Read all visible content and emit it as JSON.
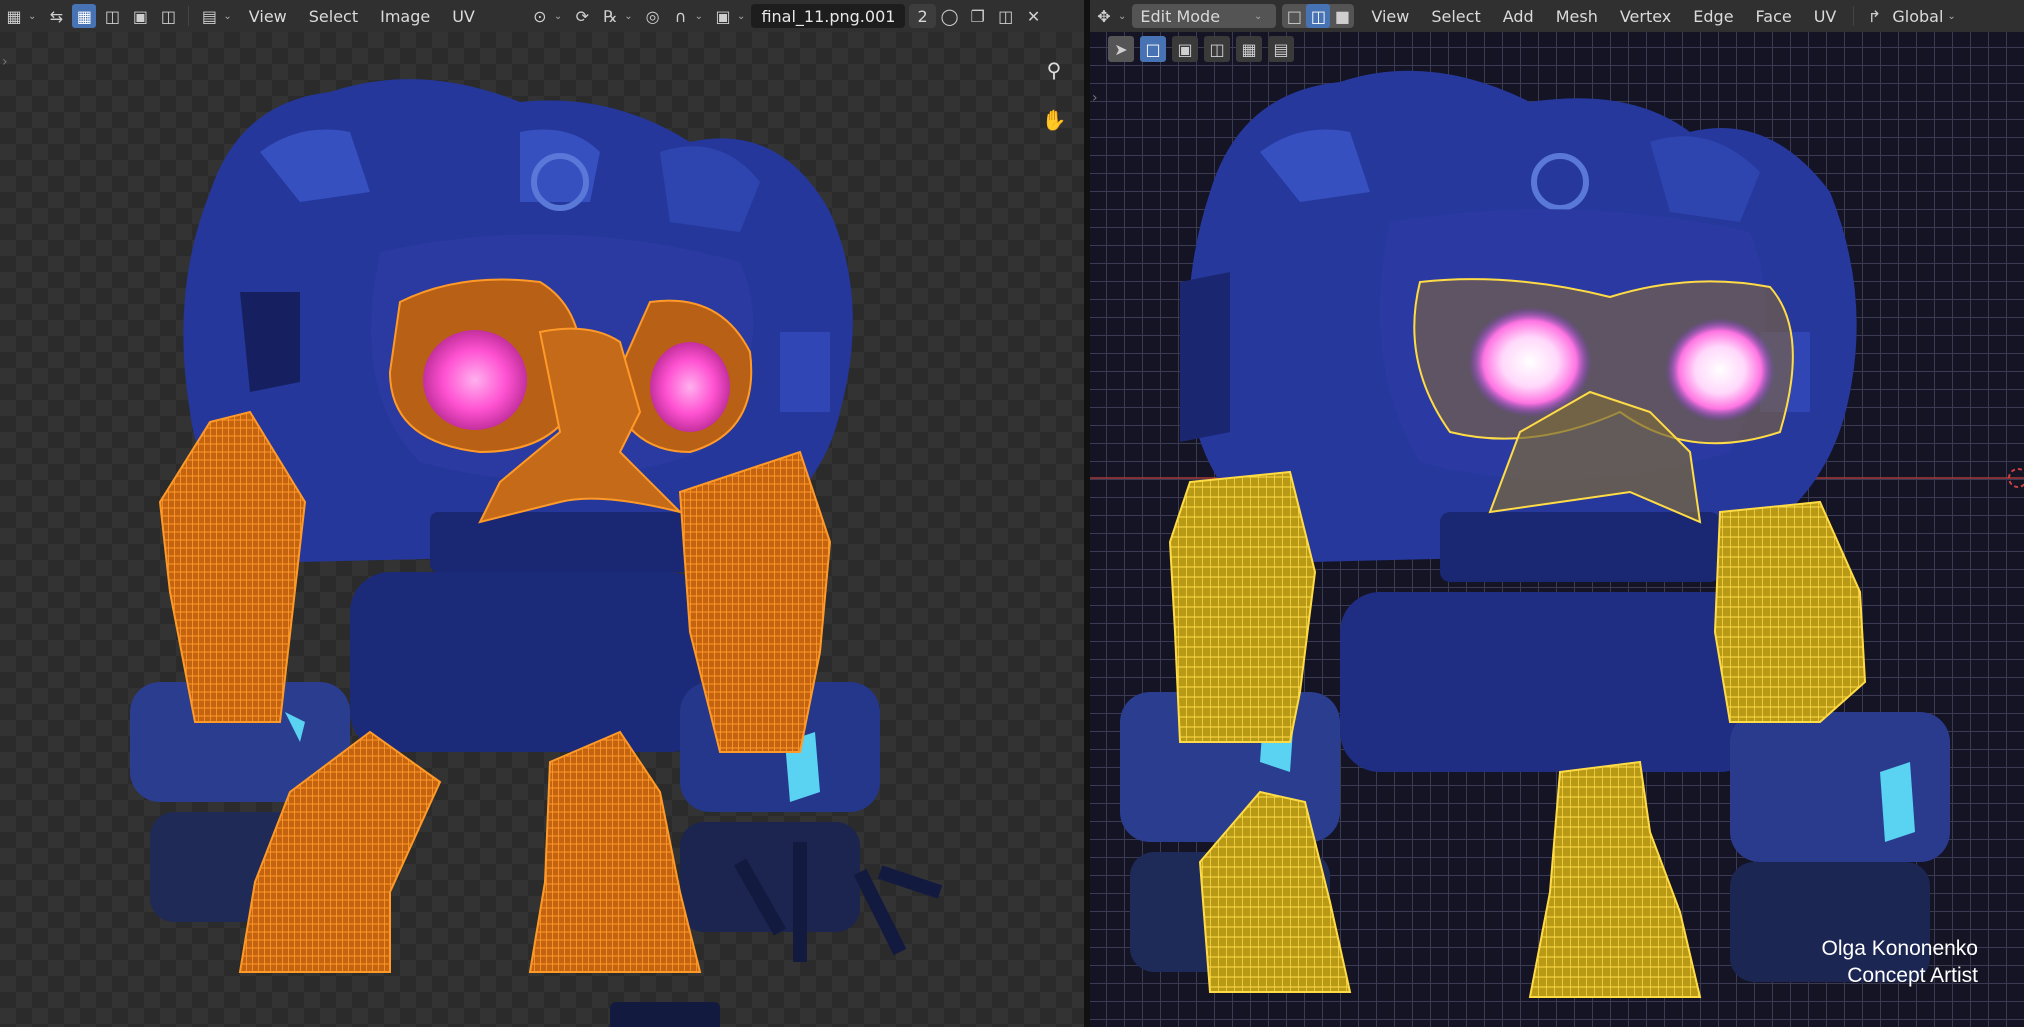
{
  "colors": {
    "uv_wire": "#ff8a1a",
    "vp_wire": "#ffd23a",
    "eye_glow": "#ff52d2",
    "stone": "#2a3e9e"
  },
  "uv_editor": {
    "icons": [
      "uv-editor-type-icon",
      "sync-selection-icon",
      "vertex-select-icon",
      "edge-select-icon",
      "face-select-icon",
      "island-select-icon",
      "sticky-mode-icon",
      "pivot-icon",
      "proportional-edit-icon",
      "snap-icon",
      "display-mode-icon",
      "curve-icon",
      "image-icon",
      "fake-user-icon",
      "new-image-icon",
      "open-image-icon",
      "close-icon",
      "zoom-icon",
      "hand-icon"
    ],
    "menu": [
      "View",
      "Select",
      "Image",
      "UV"
    ],
    "image_name": "final_11.png.001",
    "user_count": "2"
  },
  "viewport": {
    "mode": "Edit Mode",
    "menu": [
      "View",
      "Select",
      "Add",
      "Mesh",
      "Vertex",
      "Edge",
      "Face",
      "UV"
    ],
    "orientation": "Global",
    "credit_name": "Olga Kononenko",
    "credit_role": "Concept Artist"
  }
}
